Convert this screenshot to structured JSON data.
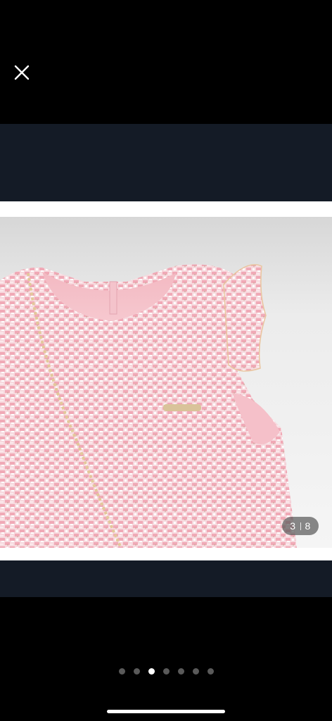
{
  "viewer": {
    "close_icon": "close-icon",
    "counter": {
      "current": "3",
      "total": "8"
    },
    "pagination": {
      "count": 7,
      "active_index": 2
    }
  },
  "colors": {
    "background": "#000000",
    "band": "#141b26",
    "fabric_pink": "#f2b8c2",
    "dot_active": "#ffffff",
    "dot_inactive": "#5a5a5a"
  }
}
